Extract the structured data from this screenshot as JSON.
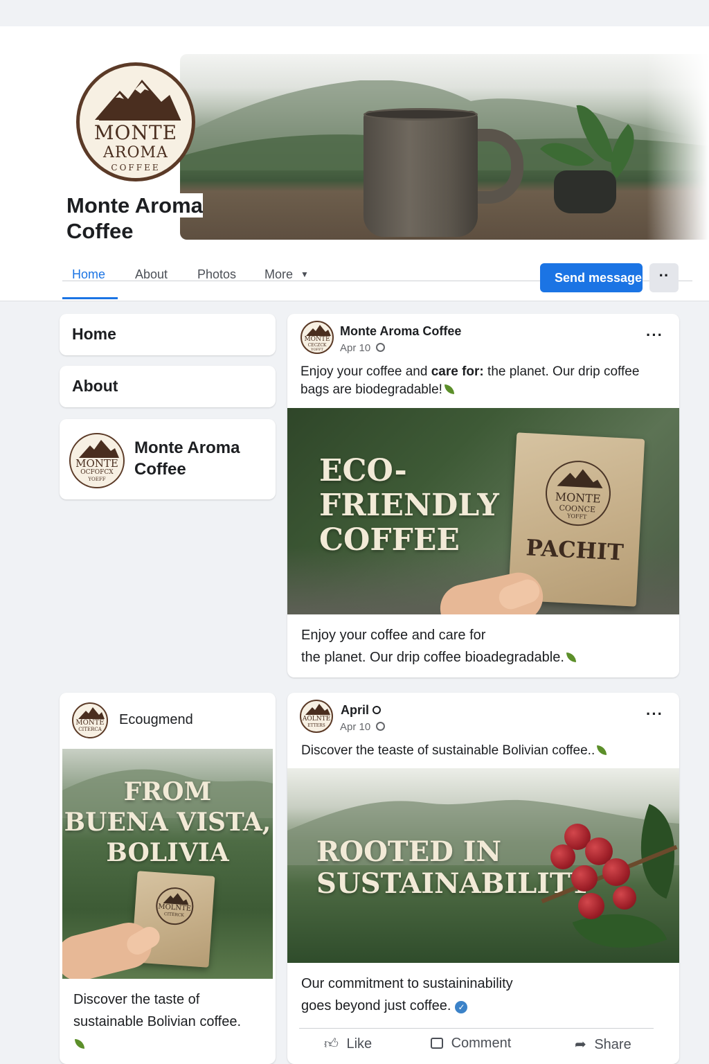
{
  "page": {
    "name": "Monte Aroma Coffee",
    "logo": {
      "line1": "MONTE",
      "line2": "AROMA",
      "line3": "COFFEE"
    }
  },
  "nav": {
    "tabs": [
      {
        "label": "Home",
        "active": true
      },
      {
        "label": "About",
        "active": false
      },
      {
        "label": "Photos",
        "active": false
      },
      {
        "label": "More",
        "active": false
      }
    ],
    "more_caret": "▼",
    "send_message": "Send message",
    "more_options": "··"
  },
  "sidebar": {
    "home": "Home",
    "about": "About",
    "profile_name": "Monte Aroma Coffee",
    "profile_logo": {
      "line1": "MONTE",
      "line2": "OCFOFCX",
      "line3": "YOEFF"
    }
  },
  "posts": [
    {
      "author": "Monte Aroma Coffee",
      "date": "Apr 10",
      "logo": {
        "line1": "MONTE",
        "line2": "CECZCK",
        "line3": "YOFFT"
      },
      "text_before": "Enjoy your coffee and ",
      "text_bold": "care for:",
      "text_after": "  the planet. Our drip coffee bags are biodegradable!",
      "image": {
        "headline": [
          "ECO-",
          "FRIENDLY",
          "COFFEE"
        ],
        "pouch_line1": "MONTE",
        "pouch_line2": "COONCE",
        "pouch_line3": "YOFFT",
        "pouch_label": "PACHIT"
      },
      "caption_line1": "Enjoy your coffee and care for",
      "caption_line2": "the planet. Our drip coffee bioadegradable."
    },
    {
      "author": "Ecougmend",
      "logo": {
        "line1": "MONTE",
        "line2": "CITERCA",
        "line3": ""
      },
      "image": {
        "headline": [
          "FROM",
          "BUENA VISTA,",
          "BOLIVIA"
        ],
        "pouch_line1": "MOLNTE",
        "pouch_line2": "CITERCK"
      },
      "caption_line1": "Discover the taste of",
      "caption_line2": "sustainable Bolivian coffee."
    },
    {
      "author": "April",
      "date": "Apr 10",
      "logo": {
        "line1": "AOLNTE",
        "line2": "ETTERS",
        "line3": ""
      },
      "text": "Discover the teaste of sustainable Bolivian coffee..",
      "image": {
        "headline": [
          "ROOTED IN",
          "SUSTAINABILITY"
        ]
      },
      "caption_line1": "Our commitment to sustaininability",
      "caption_line2": "goes beyond just coffee.",
      "actions": {
        "like": "Like",
        "comment": "Comment",
        "share": "Share"
      }
    }
  ],
  "colors": {
    "brand_blue": "#1b74e4",
    "logo_brown": "#4a2e1f",
    "leaf_green": "#5c8f2a"
  },
  "icons": [
    "globe-icon",
    "leaf-icon",
    "verified-icon",
    "like-icon",
    "comment-icon",
    "share-icon",
    "more-dots-icon"
  ]
}
